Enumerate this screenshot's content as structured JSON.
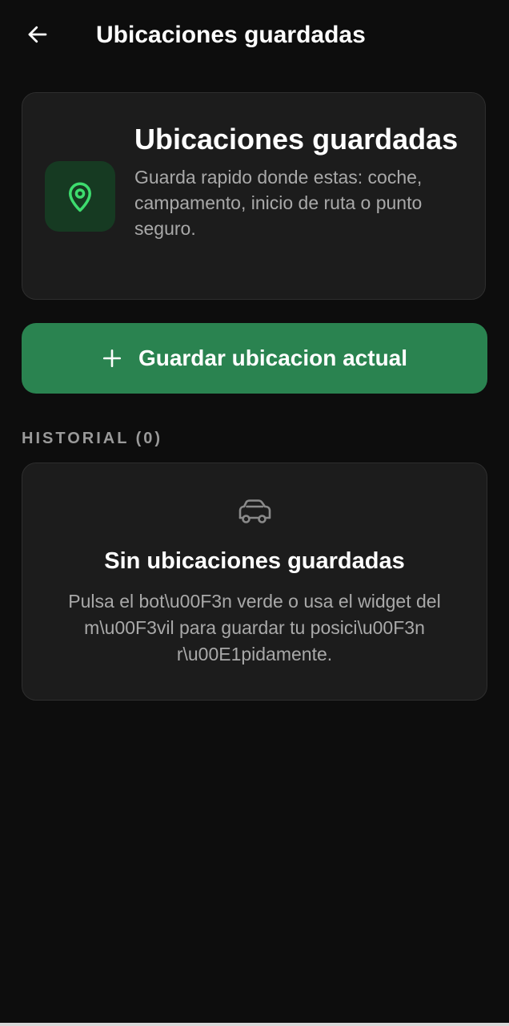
{
  "header": {
    "back_icon": "arrow-left-icon",
    "title": "Ubicaciones guardadas"
  },
  "info_card": {
    "icon": "location-pin-icon",
    "title": "Ubicaciones guardadas",
    "description": "Guarda rapido donde estas: coche, campamento, inicio de ruta o punto seguro."
  },
  "save_button": {
    "icon": "plus-icon",
    "label": "Guardar ubicacion actual"
  },
  "history": {
    "heading": "HISTORIAL (0)"
  },
  "empty_state": {
    "icon": "car-icon",
    "title": "Sin ubicaciones guardadas",
    "description": "Pulsa el bot\\u00F3n verde o usa el widget del m\\u00F3vil para guardar tu posici\\u00F3n r\\u00E1pidamente."
  },
  "colors": {
    "background": "#0d0d0d",
    "card": "#1c1c1c",
    "accent_green": "#2a8350",
    "icon_green": "#3ddc6e",
    "icon_tile": "#163a22"
  }
}
